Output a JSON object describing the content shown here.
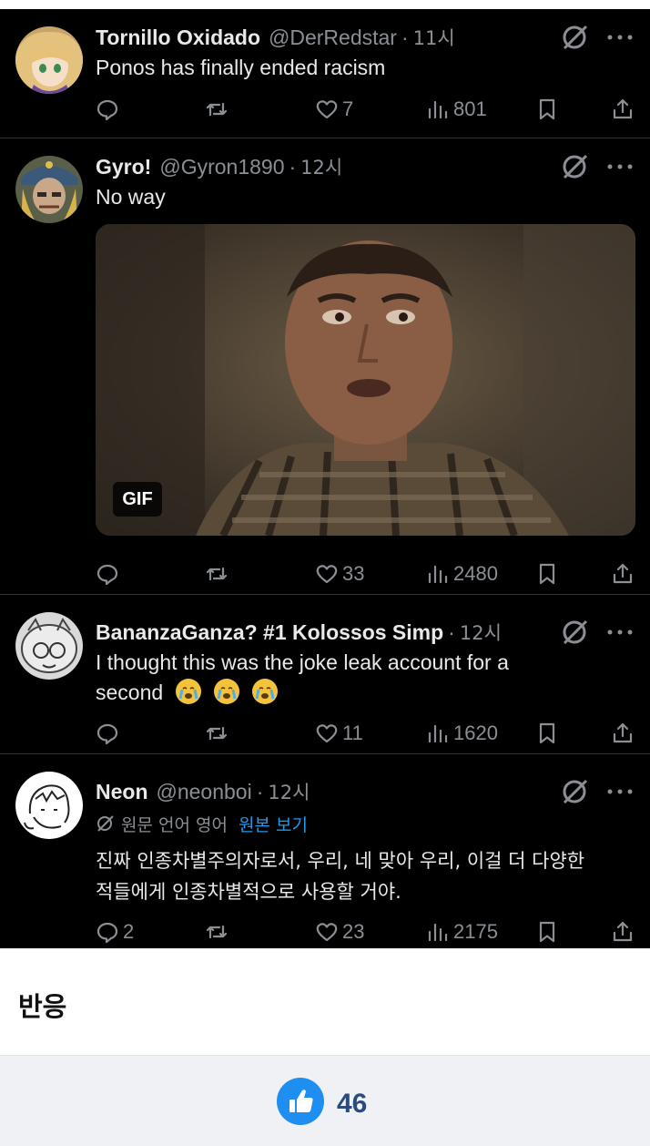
{
  "posts": [
    {
      "name": "Tornillo Oxidado",
      "handle": "@DerRedstar",
      "dot": "·",
      "time": "11시",
      "text": "Ponos has finally ended racism",
      "replies": "",
      "likes": "7",
      "views": "801"
    },
    {
      "name": "Gyro!",
      "handle": "@Gyron1890",
      "dot": "·",
      "time": "12시",
      "text": "No way",
      "gif_label": "GIF",
      "replies": "",
      "likes": "33",
      "views": "2480"
    },
    {
      "name": "BananzaGanza? #1 Kolossos Simp",
      "handle": "",
      "dot": "·",
      "time": "12시",
      "text_line1": "I thought this was the joke leak account for a",
      "text_line2": "second",
      "replies": "",
      "likes": "11",
      "views": "1620"
    },
    {
      "name": "Neon",
      "handle": "@neonboi",
      "dot": "·",
      "time": "12시",
      "translate_meta": "원문 언어 영어",
      "translate_link": "원본 보기",
      "text_line1": "진짜 인종차별주의자로서, 우리, 네 맞아 우리, 이걸 더 다양한",
      "text_line2": "적들에게 인종차별적으로 사용할 거야.",
      "replies": "2",
      "likes": "23",
      "views": "2175"
    }
  ],
  "reactions": {
    "title": "반응",
    "like_count": "46"
  },
  "colors": {
    "feed_bg": "#000000",
    "muted": "#8b8f94",
    "link": "#1d9bf0",
    "like_button": "#1e8ef0"
  }
}
